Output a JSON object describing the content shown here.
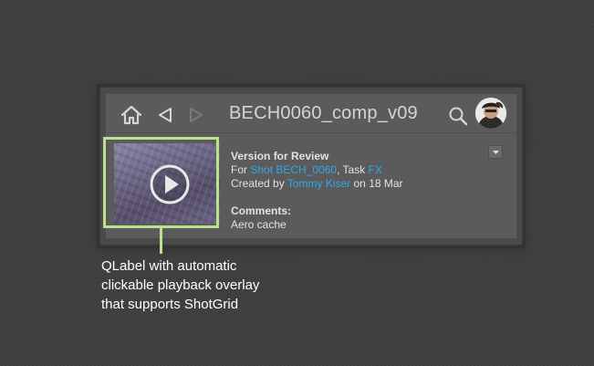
{
  "header": {
    "title": "BECH0060_comp_v09",
    "icons": [
      "home-icon",
      "back-icon",
      "forward-icon",
      "search-icon"
    ],
    "avatar": "user-avatar"
  },
  "thumbnail": {
    "overlay_icon": "play-icon"
  },
  "info": {
    "heading": "Version for Review",
    "for_prefix": "For ",
    "shot_link": "Shot BECH_0060",
    "task_sep": ", Task ",
    "task_link": "FX",
    "created_prefix": "Created by ",
    "user_link": "Tommy Kiser",
    "created_suffix": " on 18 Mar",
    "comments_label": "Comments:",
    "comments_text": "Aero cache"
  },
  "dropdown": {
    "icon": "chevron-down-icon"
  },
  "caption": {
    "lines": [
      "QLabel with automatic",
      "clickable playback overlay",
      "that supports ShotGrid"
    ]
  },
  "colors": {
    "link": "#2fa8e8",
    "highlight": "#b9e28f",
    "background": "#3f3f3f",
    "panel": "#5b5b5b"
  }
}
